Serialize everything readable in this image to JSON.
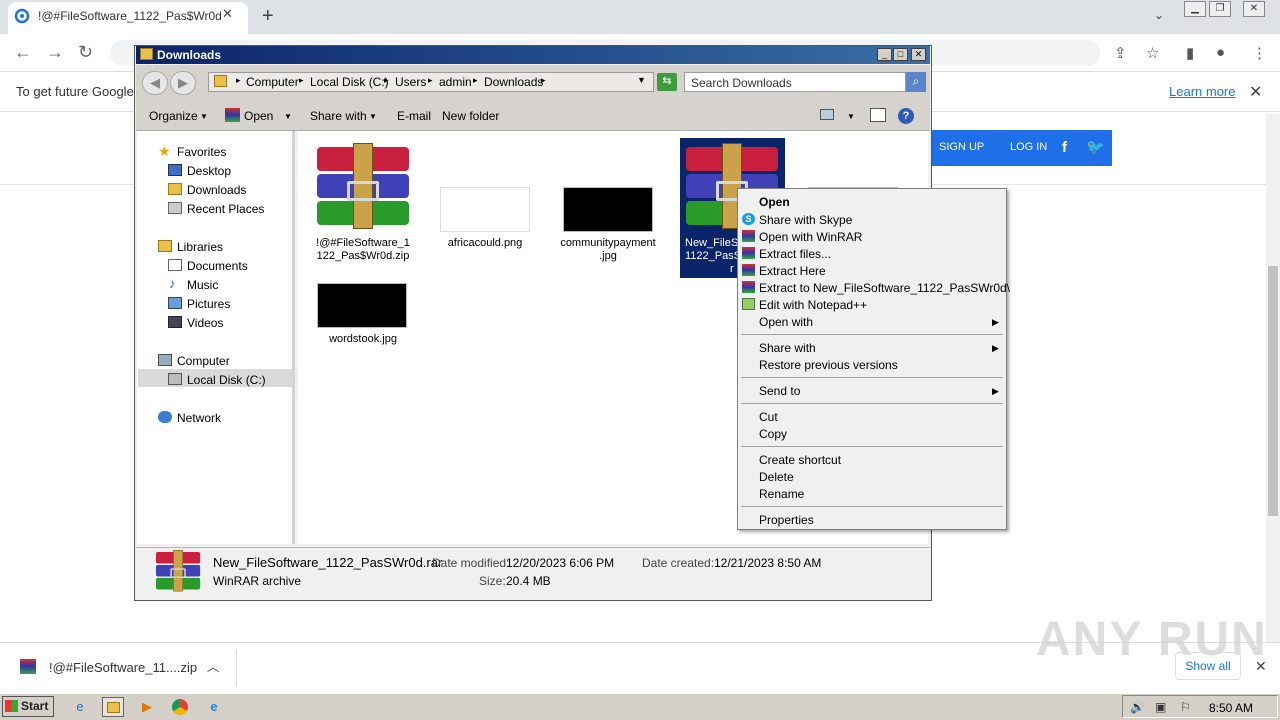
{
  "browser": {
    "tab_title": "!@#FileSoftware_1122_Pas$Wr0d",
    "infobar_text": "To get future Google",
    "learn_more": "Learn more"
  },
  "site": {
    "signup": "SIGN UP",
    "login": "LOG IN"
  },
  "explorer": {
    "title": "Downloads",
    "breadcrumbs": [
      "Computer",
      "Local Disk (C:)",
      "Users",
      "admin",
      "Downloads"
    ],
    "search_placeholder": "Search Downloads",
    "commands": [
      "Organize",
      "Open",
      "Share with",
      "E-mail",
      "New folder"
    ],
    "nav": {
      "favorites": "Favorites",
      "fav_items": [
        "Desktop",
        "Downloads",
        "Recent Places"
      ],
      "libraries": "Libraries",
      "lib_items": [
        "Documents",
        "Music",
        "Pictures",
        "Videos"
      ],
      "computer": "Computer",
      "local_disk": "Local Disk (C:)",
      "network": "Network"
    },
    "files": [
      {
        "name": "!@#FileSoftware_1122_Pas$Wr0d.zip",
        "line1": "!@#FileSoftware_1",
        "line2": "122_Pas$Wr0d.zip"
      },
      {
        "name": "africacould.png",
        "line1": "africacould.png",
        "line2": ""
      },
      {
        "name": "communitypayment.jpg",
        "line1": "communitypayment",
        "line2": ".jpg"
      },
      {
        "name": "New_FileSoftware_1122_PasSWr0d.rar",
        "line1": "New_FileSo",
        "line2": "1122_PasS",
        "line3": "r"
      },
      {
        "name": "wordstook.jpg",
        "line1": "wordstook.jpg",
        "line2": ""
      }
    ],
    "details": {
      "filename": "New_FileSoftware_1122_PasSWr0d.rar",
      "type": "WinRAR archive",
      "modified_label": "Date modified:",
      "modified": "12/20/2023 6:06 PM",
      "created_label": "Date created:",
      "created": "12/21/2023 8:50 AM",
      "size_label": "Size:",
      "size": "20.4 MB"
    }
  },
  "context_menu": {
    "open": "Open",
    "share_skype": "Share with Skype",
    "open_winrar": "Open with WinRAR",
    "extract_files": "Extract files...",
    "extract_here": "Extract Here",
    "extract_to": "Extract to New_FileSoftware_1122_PasSWr0d\\",
    "edit_npp": "Edit with Notepad++",
    "open_with": "Open with",
    "share_with": "Share with",
    "restore": "Restore previous versions",
    "send_to": "Send to",
    "cut": "Cut",
    "copy": "Copy",
    "create_shortcut": "Create shortcut",
    "delete": "Delete",
    "rename": "Rename",
    "properties": "Properties"
  },
  "shelf": {
    "file": "!@#FileSoftware_11....zip",
    "show_all": "Show all"
  },
  "taskbar": {
    "start": "Start",
    "clock": "8:50 AM"
  },
  "watermark": "ANY RUN"
}
